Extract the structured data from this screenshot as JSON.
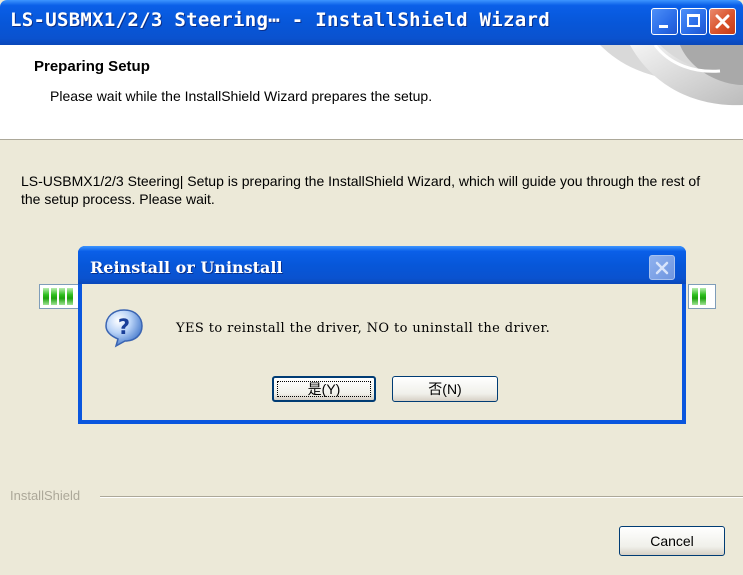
{
  "window": {
    "title": "LS-USBMX1/2/3 Steering⋯ - InstallShield Wizard",
    "controls": [
      "minimize",
      "maximize",
      "close"
    ]
  },
  "header": {
    "title": "Preparing Setup",
    "subtitle": "Please wait while the InstallShield Wizard prepares the setup."
  },
  "body": {
    "message": "LS-USBMX1/2/3 Steering| Setup is preparing the InstallShield Wizard, which will guide you through the rest of the setup process. Please wait."
  },
  "footer": {
    "group_label": "InstallShield",
    "cancel_label": "Cancel"
  },
  "dialog": {
    "title": "Reinstall or Uninstall",
    "icon": "question-icon",
    "message": "YES to reinstall the driver, NO to uninstall the driver.",
    "yes_label": "是(Y)",
    "no_label": "否(N)"
  },
  "colors": {
    "titlebar": "#0a5fe8",
    "window_bg": "#ece9d8",
    "progress_fill": "#2fbf1f",
    "close_button": "#d9532c"
  }
}
